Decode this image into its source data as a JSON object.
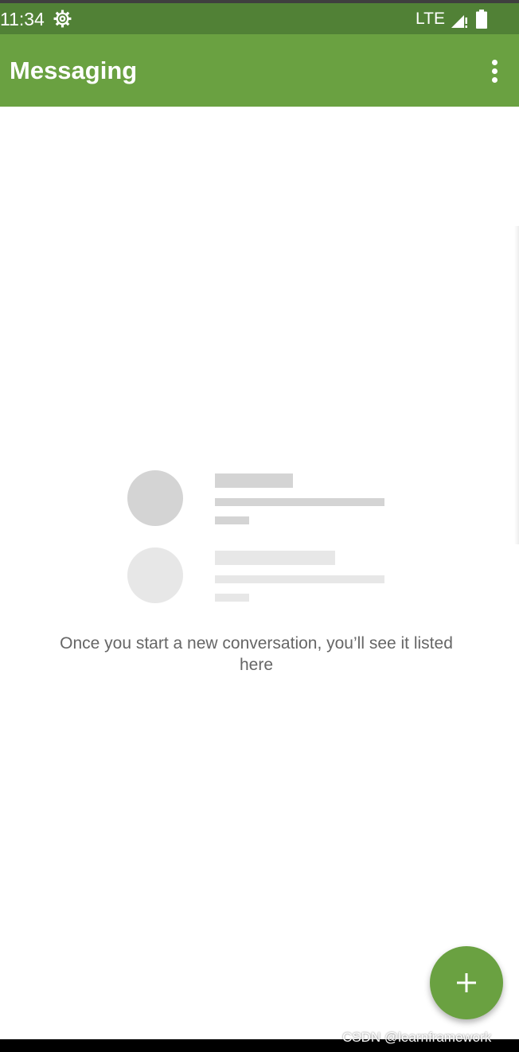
{
  "status_bar": {
    "time": "11:34",
    "network": "LTE",
    "icons": [
      "settings-gear-icon",
      "signal-icon",
      "battery-icon"
    ],
    "color": "#518136"
  },
  "app_bar": {
    "title": "Messaging",
    "overflow_icon": "more-vert-icon",
    "color": "#6aa141"
  },
  "empty_state": {
    "message": "Once you start a new conversation, you’ll see it listed here",
    "placeholder_colors": [
      "#d4d4d4",
      "#e7e7e7"
    ]
  },
  "fab": {
    "icon": "plus-icon",
    "color": "#6aa141"
  },
  "watermark": {
    "text": "CSDN @learnframework"
  }
}
